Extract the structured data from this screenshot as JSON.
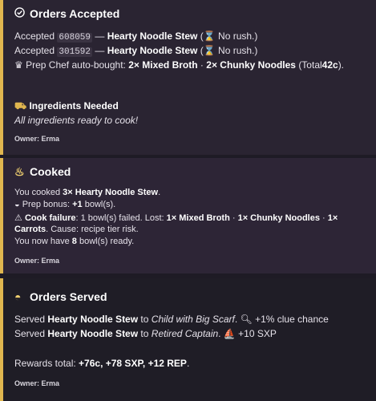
{
  "accepted": {
    "title": "Orders Accepted",
    "title_icon": "check-circle-icon",
    "orders": [
      {
        "prefix": "Accepted",
        "id": "608059",
        "sep": "—",
        "dish": "Hearty Noodle Stew",
        "note": "No rush."
      },
      {
        "prefix": "Accepted",
        "id": "301592",
        "sep": "—",
        "dish": "Hearty Noodle Stew",
        "note": "No rush."
      }
    ],
    "prep_line": {
      "text": "Prep Chef auto-bought:",
      "item1": "2× Mixed Broth",
      "dot": "·",
      "item2": "2× Chunky Noodles",
      "total_prefix": "(Total",
      "total": "42c",
      "total_suffix": ")."
    },
    "ingredients_title": "Ingredients Needed",
    "ingredients_text": "All ingredients ready to cook!",
    "owner": "Owner: Erma"
  },
  "cooked": {
    "title": "Cooked",
    "line1_pre": "You cooked",
    "line1_bold": "3× Hearty Noodle Stew",
    "line1_post": ".",
    "bonus_pre": "Prep bonus:",
    "bonus_bold": "+1",
    "bonus_post": "bowl(s).",
    "fail_bold": "Cook failure",
    "fail_text": ": 1 bowl(s) failed. Lost:",
    "lost1": "1× Mixed Broth",
    "lost2": "1× Chunky Noodles",
    "lost3a": "1×",
    "lost3b": "Carrots",
    "cause": ". Cause: recipe tier risk.",
    "have_pre": "You now have",
    "have_bold": "8",
    "have_post": "bowl(s) ready.",
    "owner": "Owner: Erma"
  },
  "served": {
    "title": "Orders Served",
    "rows": [
      {
        "pre": "Served",
        "dish": "Hearty Noodle Stew",
        "to": "to",
        "customer": "Child with Big Scarf",
        "reward": "+1% clue chance",
        "icon": "magnifier-icon"
      },
      {
        "pre": "Served",
        "dish": "Hearty Noodle Stew",
        "to": "to",
        "customer": "Retired Captain",
        "reward": "+10 SXP",
        "icon": "ship-icon"
      }
    ],
    "rewards_pre": "Rewards total:",
    "rewards_bold": "+76c, +78 SXP, +12 REP",
    "rewards_post": ".",
    "owner": "Owner: Erma"
  },
  "colors": {
    "accent": "#e0b64f",
    "bg": "#1e1b25"
  }
}
